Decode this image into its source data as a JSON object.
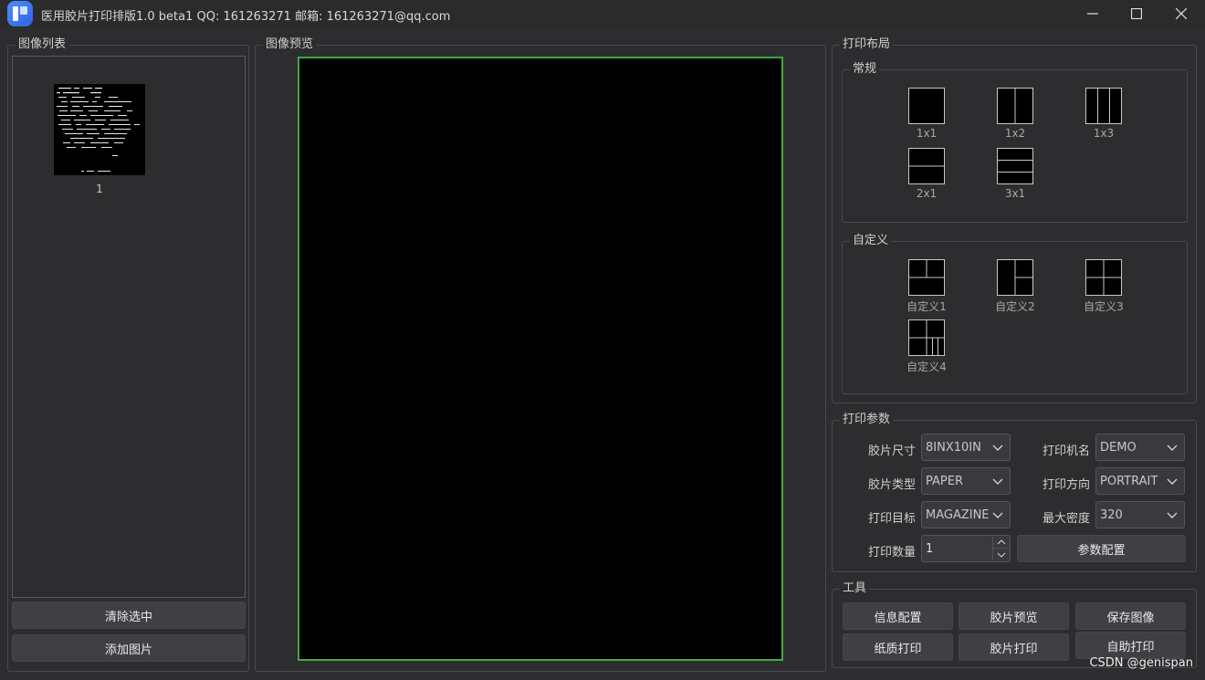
{
  "window": {
    "title": "医用胶片打印排版1.0 beta1 QQ: 161263271 邮箱: 161263271@qq.com",
    "icons": [
      "app-icon",
      "minimize-icon",
      "maximize-icon",
      "close-icon"
    ]
  },
  "image_list": {
    "title": "图像列表",
    "items": [
      {
        "caption": "1"
      }
    ],
    "clear_button": "清除选中",
    "add_button": "添加图片"
  },
  "preview": {
    "title": "图像预览",
    "frame_color": "#3dab3d"
  },
  "layout": {
    "title": "打印布局",
    "standard": {
      "title": "常规",
      "items": [
        "1x1",
        "1x2",
        "1x3",
        "2x1",
        "3x1"
      ]
    },
    "custom": {
      "title": "自定义",
      "items": [
        "自定义1",
        "自定义2",
        "自定义3",
        "自定义4"
      ]
    }
  },
  "params": {
    "title": "打印参数",
    "film_size": {
      "label": "胶片尺寸",
      "value": "8INX10IN"
    },
    "printer_name": {
      "label": "打印机名",
      "value": "DEMO"
    },
    "film_type": {
      "label": "胶片类型",
      "value": "PAPER"
    },
    "orientation": {
      "label": "打印方向",
      "value": "PORTRAIT"
    },
    "target": {
      "label": "打印目标",
      "value": "MAGAZINE"
    },
    "max_density": {
      "label": "最大密度",
      "value": "320"
    },
    "copies": {
      "label": "打印数量",
      "value": "1"
    },
    "config_button": "参数配置"
  },
  "tools": {
    "title": "工具",
    "buttons": [
      "信息配置",
      "胶片预览",
      "保存图像",
      "纸质打印",
      "胶片打印",
      "自助打印"
    ]
  },
  "watermark": "CSDN @genispan"
}
